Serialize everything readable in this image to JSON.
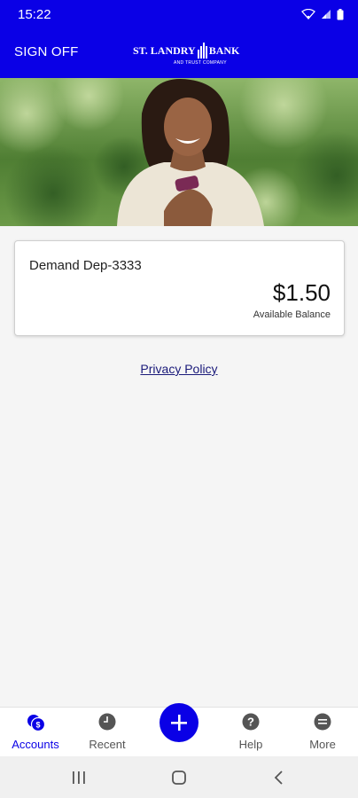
{
  "status_bar": {
    "time": "15:22"
  },
  "header": {
    "sign_off_label": "SIGN OFF",
    "logo_text_left": "ST. LANDRY",
    "logo_text_right": "BANK",
    "logo_subtext": "AND TRUST COMPANY"
  },
  "accounts": [
    {
      "name": "Demand Dep-3333",
      "amount": "$1.50",
      "balance_label": "Available Balance"
    }
  ],
  "links": {
    "privacy_policy": "Privacy Policy"
  },
  "bottom_nav": {
    "items": [
      {
        "label": "Accounts",
        "icon": "accounts-icon",
        "active": true
      },
      {
        "label": "Recent",
        "icon": "clock-icon",
        "active": false
      },
      {
        "label": "Help",
        "icon": "help-icon",
        "active": false
      },
      {
        "label": "More",
        "icon": "more-icon",
        "active": false
      }
    ],
    "fab_icon": "plus-icon"
  },
  "colors": {
    "brand": "#0a00e6",
    "background": "#f5f5f5"
  }
}
